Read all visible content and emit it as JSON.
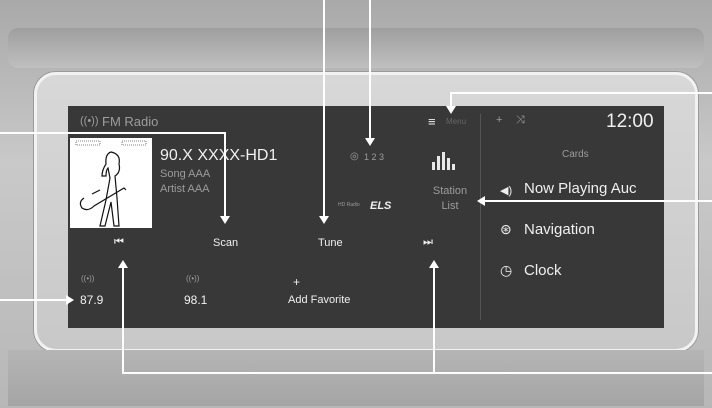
{
  "header": {
    "source_icon": "radio-signal-icon",
    "source_label": "FM Radio",
    "menu_icon": "menu-icon",
    "menu_label": "Menu",
    "time": "12:00"
  },
  "now_playing": {
    "station": "90.X XXXX-HD1",
    "song": "Song AAA",
    "artist": "Artist AAA",
    "hd_channels": "1 2 3",
    "hd_logo": "HD Radio",
    "els_logo": "ELS"
  },
  "controls": {
    "scan_label": "Scan",
    "tune_label": "Tune",
    "prev_icon": "skip-previous-icon",
    "next_icon": "skip-next-icon",
    "station_list_label": "Station List"
  },
  "favorites": [
    {
      "label": "87.9",
      "icon": "radio-signal-icon"
    },
    {
      "label": "98.1",
      "icon": "radio-signal-icon"
    },
    {
      "label": "Add Favorite",
      "icon": "plus-icon"
    }
  ],
  "cards": {
    "title": "Cards",
    "items": [
      {
        "label": "Now Playing Auc",
        "icon": "speaker-icon"
      },
      {
        "label": "Navigation",
        "icon": "navigation-icon"
      },
      {
        "label": "Clock",
        "icon": "clock-icon"
      }
    ]
  },
  "colors": {
    "screen_bg": "#383838",
    "text": "#f0f0f0",
    "dim_text": "#9c9c9c"
  }
}
